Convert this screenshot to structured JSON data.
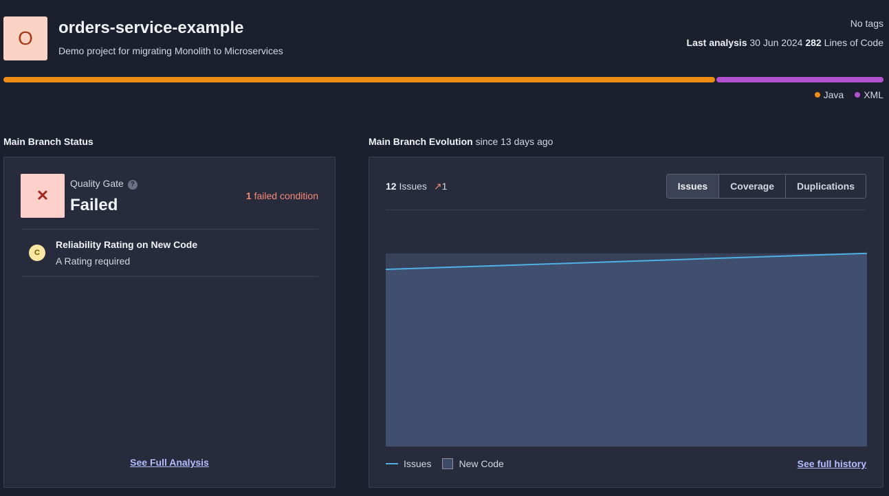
{
  "project": {
    "avatar_letter": "O",
    "title": "orders-service-example",
    "description": "Demo project for migrating Monolith to Microservices",
    "tags": "No tags",
    "last_analysis_label": "Last analysis",
    "last_analysis_date": "30 Jun 2024",
    "loc_value": "282",
    "loc_label": "Lines of Code"
  },
  "languages": [
    {
      "name": "Java",
      "color": "#ef8c13",
      "share": 0.81
    },
    {
      "name": "XML",
      "color": "#b352d1",
      "share": 0.19
    }
  ],
  "status": {
    "section_title": "Main Branch Status",
    "quality_gate_label": "Quality Gate",
    "help_icon": "?",
    "badge_icon": "✕",
    "status_text": "Failed",
    "failed_count": "1",
    "failed_text": "failed condition",
    "condition": {
      "rating": "C",
      "title": "Reliability Rating on New Code",
      "subtitle": "A Rating required"
    },
    "link": "See Full Analysis"
  },
  "evolution": {
    "section_title": "Main Branch Evolution",
    "section_sub": "since 13 days ago",
    "issues_count": "12",
    "issues_label": "Issues",
    "trend_icon": "↗",
    "issues_delta": "1",
    "tabs": [
      {
        "label": "Issues",
        "active": true
      },
      {
        "label": "Coverage",
        "active": false
      },
      {
        "label": "Duplications",
        "active": false
      }
    ],
    "legend_issues": "Issues",
    "legend_new_code": "New Code",
    "link": "See full history",
    "colors": {
      "line": "#4fb2e6",
      "area": "#3f4f6d",
      "new_code": "#3f4a66"
    }
  },
  "chart_data": {
    "type": "area",
    "series": [
      {
        "name": "Issues",
        "values": [
          11,
          12
        ]
      }
    ],
    "ylim": [
      0,
      12.5
    ],
    "grid": false,
    "legend": "bottom-left"
  }
}
